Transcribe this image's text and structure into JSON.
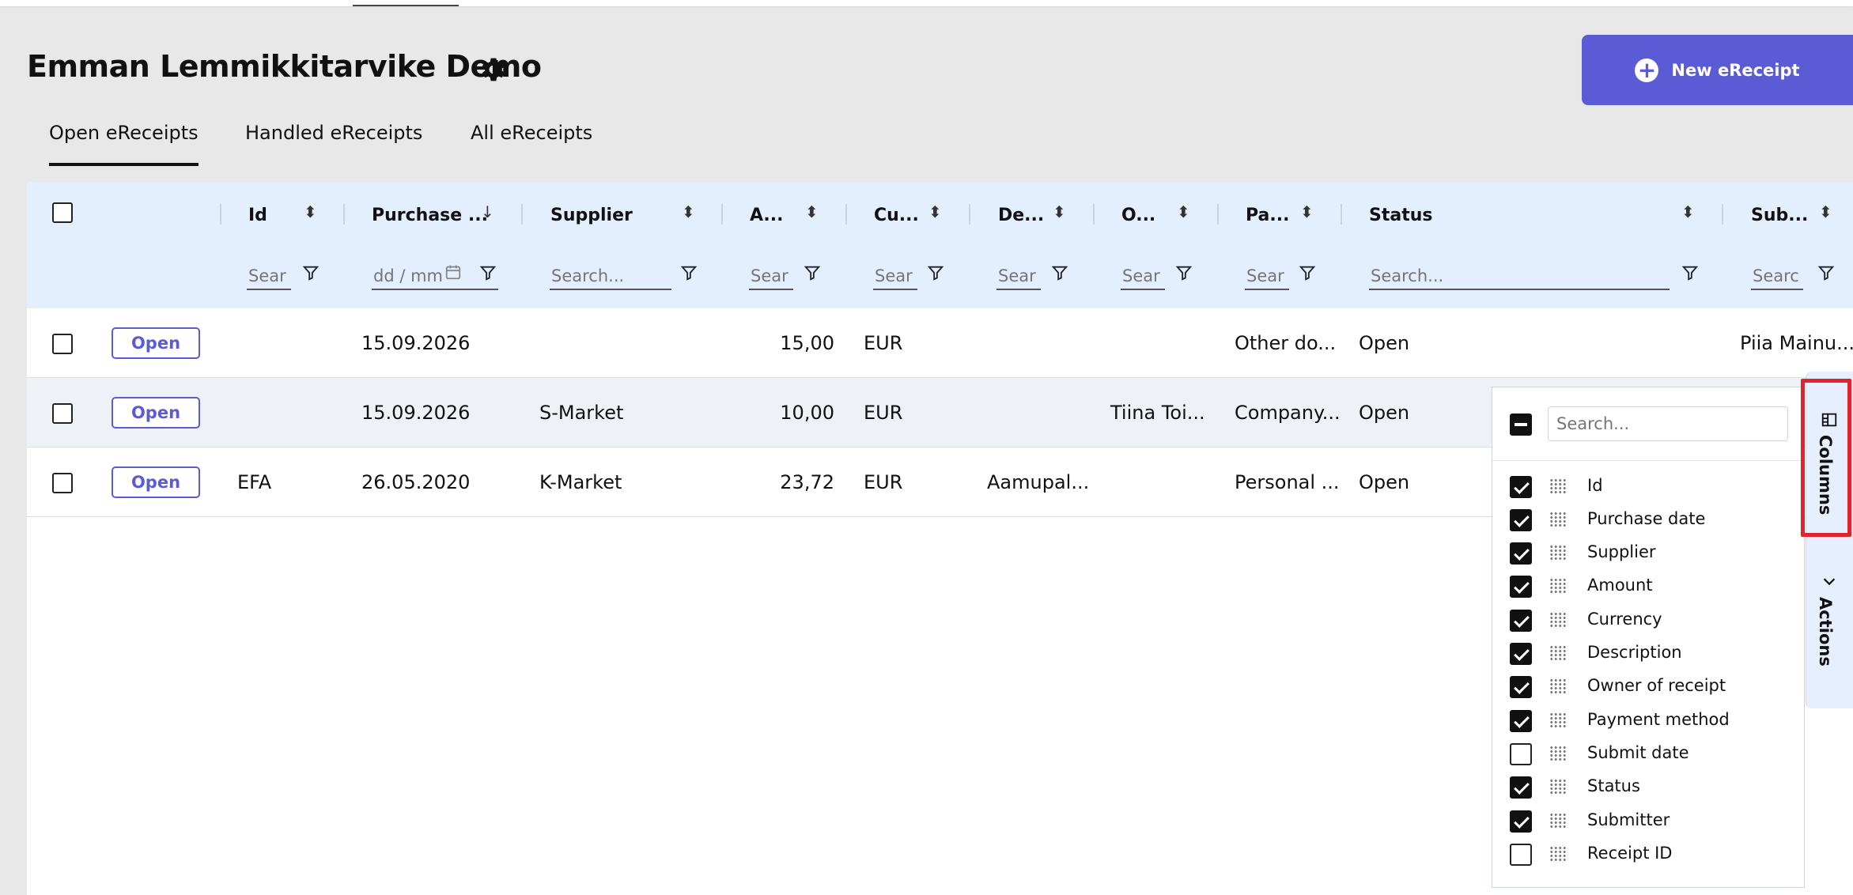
{
  "page": {
    "title": "Emman Lemmikkitarvike Demo",
    "new_button": "New eReceipt",
    "tabs": [
      "Open eReceipts",
      "Handled eReceipts",
      "All eReceipts"
    ],
    "accent": "#5b5bd6"
  },
  "grid": {
    "columns": [
      {
        "label": "Id",
        "filter_placeholder": "Sear"
      },
      {
        "label": "Purchase ...",
        "filter_placeholder": "dd / mm"
      },
      {
        "label": "Supplier",
        "filter_placeholder": "Search..."
      },
      {
        "label": "A...",
        "filter_placeholder": "Sear"
      },
      {
        "label": "Cu...",
        "filter_placeholder": "Sear"
      },
      {
        "label": "De...",
        "filter_placeholder": "Sear"
      },
      {
        "label": "O...",
        "filter_placeholder": "Sear"
      },
      {
        "label": "Pa...",
        "filter_placeholder": "Sear"
      },
      {
        "label": "Status",
        "filter_placeholder": "Search..."
      },
      {
        "label": "Sub...",
        "filter_placeholder": "Searc"
      }
    ],
    "open_label": "Open",
    "rows": [
      {
        "id": "",
        "purchase_date": "15.09.2026",
        "supplier": "",
        "amount": "15,00",
        "currency": "EUR",
        "description": "",
        "owner": "",
        "payment": "Other do...",
        "status": "Open",
        "submitter": "Piia Mainu..."
      },
      {
        "id": "",
        "purchase_date": "15.09.2026",
        "supplier": "S-Market",
        "amount": "10,00",
        "currency": "EUR",
        "description": "",
        "owner": "Tiina Toi...",
        "payment": "Company...",
        "status": "Open",
        "submitter": ""
      },
      {
        "id": "EFA",
        "purchase_date": "26.05.2020",
        "supplier": "K-Market",
        "amount": "23,72",
        "currency": "EUR",
        "description": "Aamupal...",
        "owner": "",
        "payment": "Personal ...",
        "status": "Open",
        "submitter": ""
      }
    ]
  },
  "column_panel": {
    "search_placeholder": "Search...",
    "items": [
      {
        "label": "Id",
        "checked": true
      },
      {
        "label": "Purchase date",
        "checked": true
      },
      {
        "label": "Supplier",
        "checked": true
      },
      {
        "label": "Amount",
        "checked": true
      },
      {
        "label": "Currency",
        "checked": true
      },
      {
        "label": "Description",
        "checked": true
      },
      {
        "label": "Owner of receipt",
        "checked": true
      },
      {
        "label": "Payment method",
        "checked": true
      },
      {
        "label": "Submit date",
        "checked": false
      },
      {
        "label": "Status",
        "checked": true
      },
      {
        "label": "Submitter",
        "checked": true
      },
      {
        "label": "Receipt ID",
        "checked": false
      }
    ]
  },
  "side_tabs": {
    "columns": "Columns",
    "actions": "Actions"
  }
}
